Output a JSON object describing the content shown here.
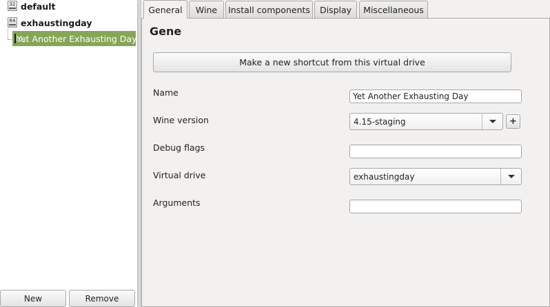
{
  "tree": {
    "prefixes": [
      {
        "name": "default",
        "arch": "32"
      },
      {
        "name": "exhaustingday",
        "arch": "64"
      }
    ],
    "shortcut": {
      "label": "Yet Another Exhausting Day"
    }
  },
  "left_buttons": {
    "new": "New",
    "remove": "Remove"
  },
  "tabs": [
    {
      "label": "General",
      "active": true
    },
    {
      "label": "Wine",
      "active": false
    },
    {
      "label": "Install components",
      "active": false
    },
    {
      "label": "Display",
      "active": false
    },
    {
      "label": "Miscellaneous",
      "active": false
    }
  ],
  "general": {
    "section_title": "Gene",
    "make_shortcut_label": "Make a new shortcut from this virtual drive",
    "name_label": "Name",
    "name_value": "Yet Another Exhausting Day",
    "wine_version_label": "Wine version",
    "wine_version_value": "4.15-staging",
    "add_version_symbol": "+",
    "debug_flags_label": "Debug flags",
    "debug_flags_value": "",
    "virtual_drive_label": "Virtual drive",
    "virtual_drive_value": "exhaustingday",
    "arguments_label": "Arguments",
    "arguments_value": ""
  },
  "colors": {
    "selection": "#87a556",
    "window_bg": "#f2f1f0",
    "tree_bg": "#ffffff"
  },
  "icons": [
    "arch-32-icon",
    "arch-64-icon",
    "game-shortcut-icon",
    "chevron-down-icon",
    "plus-icon"
  ]
}
